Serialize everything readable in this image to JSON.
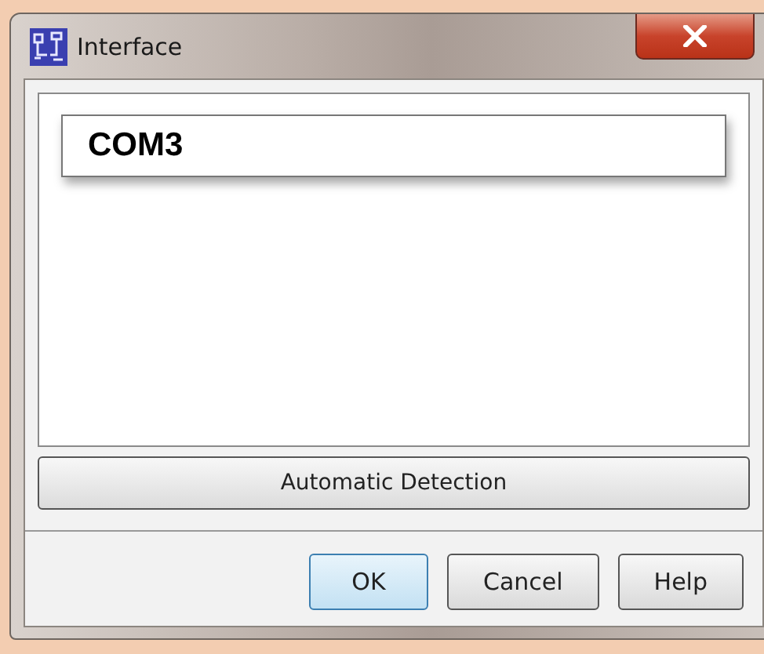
{
  "window": {
    "title": "Interface"
  },
  "ports": [
    {
      "name": "COM3",
      "selected": true
    }
  ],
  "detect_button": {
    "label": "Automatic Detection"
  },
  "buttons": [
    {
      "label": "OK",
      "default": true
    },
    {
      "label": "Cancel",
      "default": false
    },
    {
      "label": "Help",
      "default": false
    }
  ]
}
